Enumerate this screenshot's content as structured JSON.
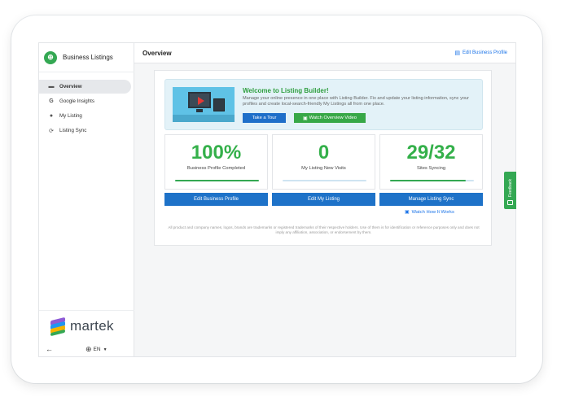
{
  "brand": {
    "title": "Business Listings",
    "logo_icon": "globe-icon"
  },
  "sidebar": {
    "items": [
      {
        "label": "Overview",
        "icon": "dashboard-icon",
        "active": true
      },
      {
        "label": "Google Insights",
        "icon": "google-icon",
        "active": false
      },
      {
        "label": "My Listing",
        "icon": "map-pin-icon",
        "active": false
      },
      {
        "label": "Listing Sync",
        "icon": "sync-icon",
        "active": false
      }
    ],
    "footer": {
      "logo_text": "martek",
      "language": "EN"
    }
  },
  "header": {
    "title": "Overview",
    "edit_profile_label": "Edit Business Profile"
  },
  "welcome": {
    "title": "Welcome to Listing Builder!",
    "description": "Manage your online presence in one place with Listing Builder. Fix and update your listing information, sync your profiles and create local-search-friendly My Listings all from one place.",
    "tour_label": "Take a Tour",
    "video_label": "Watch Overview Video"
  },
  "stats": [
    {
      "value": "100%",
      "label": "Business Profile Completed",
      "progress": 1.0,
      "action": "Edit Business Profile"
    },
    {
      "value": "0",
      "label": "My Listing New Visits",
      "progress": 0.0,
      "action": "Edit My Listing"
    },
    {
      "value": "29/32",
      "label": "Sites Syncing",
      "progress": 0.906,
      "action": "Manage Listing Sync"
    }
  ],
  "watch_how_label": "Watch How It Works",
  "disclaimer": "All product and company names, logos, brands are trademarks or registered trademarks of their respective holders. Use of them is for identification or reference purposes only and does not imply any affiliation, association, or endorsement by them.",
  "feedback_label": "Feedback",
  "colors": {
    "primary": "#1e72c8",
    "success": "#34a853",
    "link": "#1a73e8"
  }
}
